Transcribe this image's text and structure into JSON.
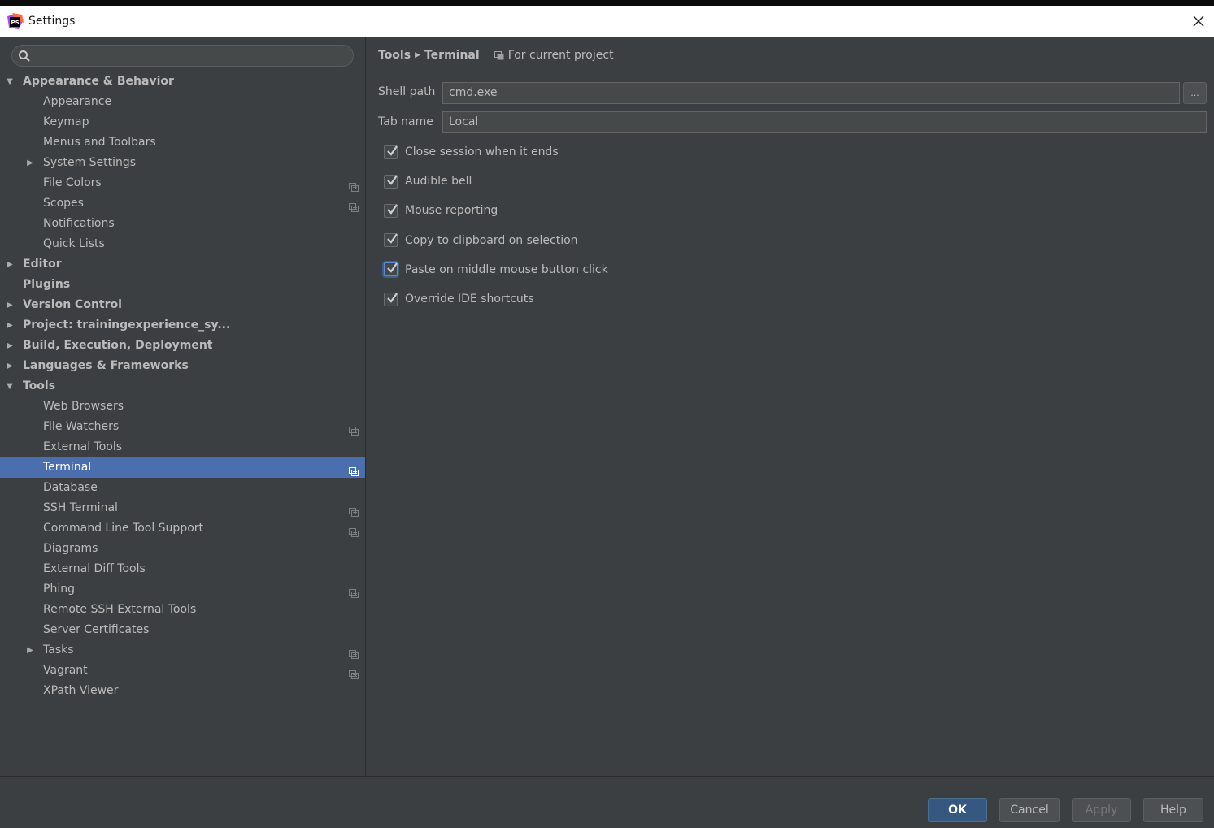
{
  "window": {
    "title": "Settings"
  },
  "search": {
    "placeholder": ""
  },
  "sidebar": {
    "items": [
      {
        "label": "Appearance & Behavior",
        "level": 0,
        "arrow": "expanded",
        "name": "sidebar-item-appearance-behavior"
      },
      {
        "label": "Appearance",
        "level": 1,
        "name": "sidebar-item-appearance"
      },
      {
        "label": "Keymap",
        "level": 1,
        "name": "sidebar-item-keymap"
      },
      {
        "label": "Menus and Toolbars",
        "level": 1,
        "name": "sidebar-item-menus-toolbars"
      },
      {
        "label": "System Settings",
        "level": 1,
        "arrow": "collapsed",
        "name": "sidebar-item-system-settings"
      },
      {
        "label": "File Colors",
        "level": 1,
        "project": true,
        "name": "sidebar-item-file-colors"
      },
      {
        "label": "Scopes",
        "level": 1,
        "project": true,
        "name": "sidebar-item-scopes"
      },
      {
        "label": "Notifications",
        "level": 1,
        "name": "sidebar-item-notifications"
      },
      {
        "label": "Quick Lists",
        "level": 1,
        "name": "sidebar-item-quick-lists"
      },
      {
        "label": "Editor",
        "level": 0,
        "arrow": "collapsed",
        "name": "sidebar-item-editor"
      },
      {
        "label": "Plugins",
        "level": 0,
        "name": "sidebar-item-plugins"
      },
      {
        "label": "Version Control",
        "level": 0,
        "arrow": "collapsed",
        "name": "sidebar-item-version-control"
      },
      {
        "label": "Project: trainingexperience_sy...",
        "level": 0,
        "arrow": "collapsed",
        "name": "sidebar-item-project"
      },
      {
        "label": "Build, Execution, Deployment",
        "level": 0,
        "arrow": "collapsed",
        "name": "sidebar-item-build-execution-deployment"
      },
      {
        "label": "Languages & Frameworks",
        "level": 0,
        "arrow": "collapsed",
        "name": "sidebar-item-languages-frameworks"
      },
      {
        "label": "Tools",
        "level": 0,
        "arrow": "expanded",
        "name": "sidebar-item-tools"
      },
      {
        "label": "Web Browsers",
        "level": 1,
        "name": "sidebar-item-web-browsers"
      },
      {
        "label": "File Watchers",
        "level": 1,
        "project": true,
        "name": "sidebar-item-file-watchers"
      },
      {
        "label": "External Tools",
        "level": 1,
        "name": "sidebar-item-external-tools"
      },
      {
        "label": "Terminal",
        "level": 1,
        "project": true,
        "selected": true,
        "name": "sidebar-item-terminal"
      },
      {
        "label": "Database",
        "level": 1,
        "name": "sidebar-item-database"
      },
      {
        "label": "SSH Terminal",
        "level": 1,
        "project": true,
        "name": "sidebar-item-ssh-terminal"
      },
      {
        "label": "Command Line Tool Support",
        "level": 1,
        "project": true,
        "name": "sidebar-item-command-line-tool-support"
      },
      {
        "label": "Diagrams",
        "level": 1,
        "name": "sidebar-item-diagrams"
      },
      {
        "label": "External Diff Tools",
        "level": 1,
        "name": "sidebar-item-external-diff-tools"
      },
      {
        "label": "Phing",
        "level": 1,
        "project": true,
        "name": "sidebar-item-phing"
      },
      {
        "label": "Remote SSH External Tools",
        "level": 1,
        "name": "sidebar-item-remote-ssh-external-tools"
      },
      {
        "label": "Server Certificates",
        "level": 1,
        "name": "sidebar-item-server-certificates"
      },
      {
        "label": "Tasks",
        "level": 1,
        "arrow": "collapsed",
        "project": true,
        "name": "sidebar-item-tasks"
      },
      {
        "label": "Vagrant",
        "level": 1,
        "project": true,
        "name": "sidebar-item-vagrant"
      },
      {
        "label": "XPath Viewer",
        "level": 1,
        "name": "sidebar-item-xpath-viewer"
      }
    ]
  },
  "breadcrumb": {
    "parent": "Tools",
    "current": "Terminal",
    "scope": "For current project"
  },
  "form": {
    "shell_path_label": "Shell path",
    "shell_path_value": "cmd.exe",
    "browse_label": "...",
    "tab_name_label": "Tab name",
    "tab_name_value": "Local"
  },
  "options": [
    {
      "label": "Close session when it ends",
      "checked": true,
      "name": "close-session-checkbox"
    },
    {
      "label": "Audible bell",
      "checked": true,
      "name": "audible-bell-checkbox"
    },
    {
      "label": "Mouse reporting",
      "checked": true,
      "name": "mouse-reporting-checkbox"
    },
    {
      "label": "Copy to clipboard on selection",
      "checked": true,
      "name": "copy-to-clipboard-checkbox"
    },
    {
      "label": "Paste on middle mouse button click",
      "checked": true,
      "focused": true,
      "name": "paste-middle-click-checkbox"
    },
    {
      "label": "Override IDE shortcuts",
      "checked": true,
      "name": "override-ide-shortcuts-checkbox"
    }
  ],
  "footer": {
    "ok": "OK",
    "cancel": "Cancel",
    "apply": "Apply",
    "help": "Help"
  },
  "colors": {
    "selection": "#4b6eaf",
    "background": "#3c3f41",
    "primary_button": "#365880"
  }
}
